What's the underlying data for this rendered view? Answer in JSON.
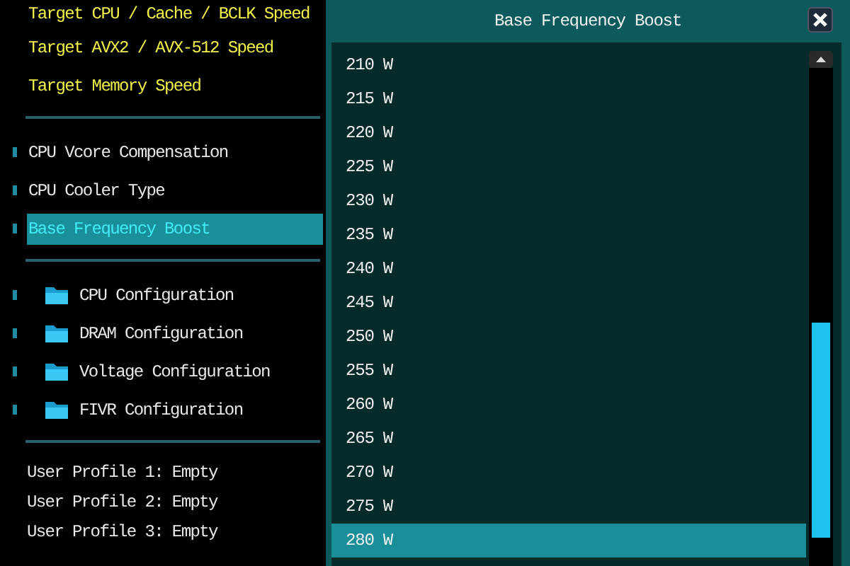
{
  "sidebar": {
    "targets": [
      "Target CPU / Cache / BCLK Speed",
      "Target AVX2 / AVX-512 Speed",
      "Target Memory Speed"
    ],
    "options": [
      {
        "label": "CPU Vcore Compensation",
        "selected": false
      },
      {
        "label": "CPU Cooler Type",
        "selected": false
      },
      {
        "label": "Base Frequency Boost",
        "selected": true
      }
    ],
    "folders": [
      "CPU Configuration",
      "DRAM Configuration",
      "Voltage Configuration",
      "FIVR Configuration"
    ],
    "profiles": [
      "User Profile 1: Empty",
      "User Profile 2: Empty",
      "User Profile 3: Empty"
    ]
  },
  "dialog": {
    "title": "Base Frequency Boost",
    "options": [
      {
        "label": "210 W",
        "selected": false
      },
      {
        "label": "215 W",
        "selected": false
      },
      {
        "label": "220 W",
        "selected": false
      },
      {
        "label": "225 W",
        "selected": false
      },
      {
        "label": "230 W",
        "selected": false
      },
      {
        "label": "235 W",
        "selected": false
      },
      {
        "label": "240 W",
        "selected": false
      },
      {
        "label": "245 W",
        "selected": false
      },
      {
        "label": "250 W",
        "selected": false
      },
      {
        "label": "255 W",
        "selected": false
      },
      {
        "label": "260 W",
        "selected": false
      },
      {
        "label": "265 W",
        "selected": false
      },
      {
        "label": "270 W",
        "selected": false
      },
      {
        "label": "275 W",
        "selected": false
      },
      {
        "label": "280 W",
        "selected": true
      }
    ]
  }
}
